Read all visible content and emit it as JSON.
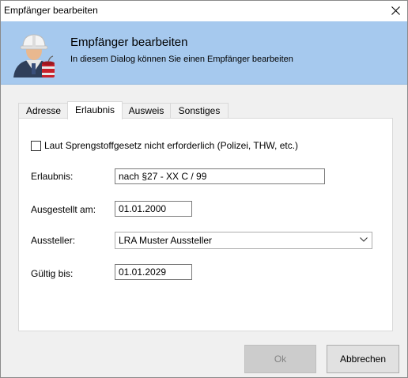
{
  "window": {
    "title": "Empfänger bearbeiten"
  },
  "header": {
    "title": "Empfänger bearbeiten",
    "subtitle": "In diesem Dialog können Sie einen Empfänger bearbeiten",
    "icon": "construction-worker-with-explosive-icon"
  },
  "tabs": [
    {
      "label": "Adresse",
      "active": false
    },
    {
      "label": "Erlaubnis",
      "active": true
    },
    {
      "label": "Ausweis",
      "active": false
    },
    {
      "label": "Sonstiges",
      "active": false
    }
  ],
  "form": {
    "checkbox": {
      "label": "Laut Sprengstoffgesetz nicht erforderlich (Polizei, THW, etc.)",
      "checked": false
    },
    "erlaubnis": {
      "label": "Erlaubnis:",
      "value": "nach §27 - XX C / 99"
    },
    "ausgestellt": {
      "label": "Ausgestellt am:",
      "value": "01.01.2000"
    },
    "aussteller": {
      "label": "Aussteller:",
      "value": "LRA Muster Aussteller"
    },
    "gueltig": {
      "label": "Gültig bis:",
      "value": "01.01.2029"
    }
  },
  "buttons": {
    "ok": "Ok",
    "cancel": "Abbrechen"
  },
  "colors": {
    "header_bg": "#a6c9ee",
    "panel_bg": "#ffffff",
    "window_bg": "#f0f0f0"
  }
}
